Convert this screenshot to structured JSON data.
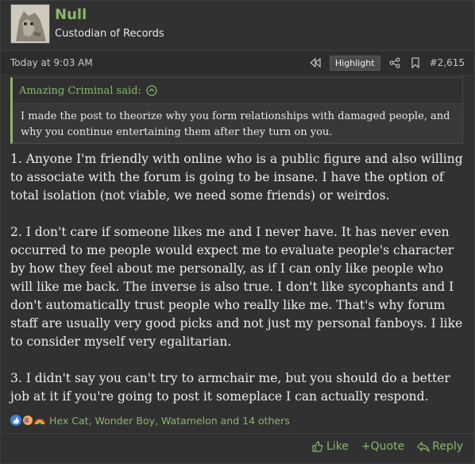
{
  "user": {
    "name": "Null",
    "title": "Custodian of Records"
  },
  "meta": {
    "date": "Today at 9:03 AM",
    "highlight_label": "Highlight",
    "post_number": "#2,615"
  },
  "quote": {
    "author": "Amazing Criminal said:",
    "text": "I made the post to theorize why you form relationships with damaged people, and why you continue entertaining them after they turn on you."
  },
  "body": {
    "paragraphs": [
      "1. Anyone I'm friendly with online who is a public figure and also willing to associate with the forum is going to be insane. I have the option of total isolation (not viable, we need some friends) or weirdos.",
      "2. I don't care if someone likes me and I never have. It has never even occurred to me people would expect me to evaluate people's character by how they feel about me personally, as if I can only like people who will like me back. The inverse is also true. I don't like sycophants and I don't automatically trust people who really like me. That's why forum staff are usually very good picks and not just my personal fanboys. I like to consider myself very egalitarian.",
      "3. I didn't say you can't try to armchair me, but you should do a better job at it if you're going to post it someplace I can actually respond."
    ]
  },
  "reactions": {
    "summary": "Hex Cat, Wonder Boy, Watamelon and 14 others"
  },
  "footer": {
    "like": "Like",
    "quote": "+Quote",
    "reply": "Reply"
  },
  "colors": {
    "accent": "#8ab66a",
    "background": "#313131"
  }
}
